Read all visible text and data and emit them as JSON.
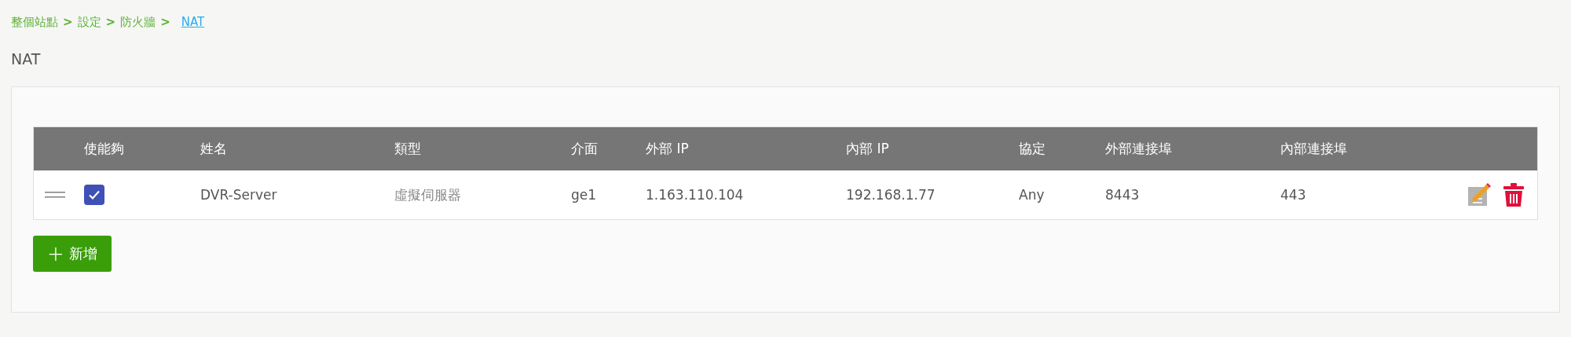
{
  "breadcrumb": [
    {
      "label": "整個站點",
      "current": false
    },
    {
      "label": "設定",
      "current": false
    },
    {
      "label": "防火牆",
      "current": false
    },
    {
      "label": "NAT",
      "current": true
    }
  ],
  "breadcrumb_separator": ">",
  "page_title": "NAT",
  "table": {
    "columns": [
      "",
      "使能夠",
      "姓名",
      "類型",
      "介面",
      "外部 IP",
      "內部 IP",
      "協定",
      "外部連接埠",
      "內部連接埠",
      ""
    ],
    "rows": [
      {
        "enabled": true,
        "name": "DVR-Server",
        "type": "虛擬伺服器",
        "interface": "ge1",
        "external_ip": "1.163.110.104",
        "internal_ip": "192.168.1.77",
        "protocol": "Any",
        "external_port": "8443",
        "internal_port": "443"
      }
    ]
  },
  "add_button": {
    "icon": "+",
    "label": "新增"
  }
}
